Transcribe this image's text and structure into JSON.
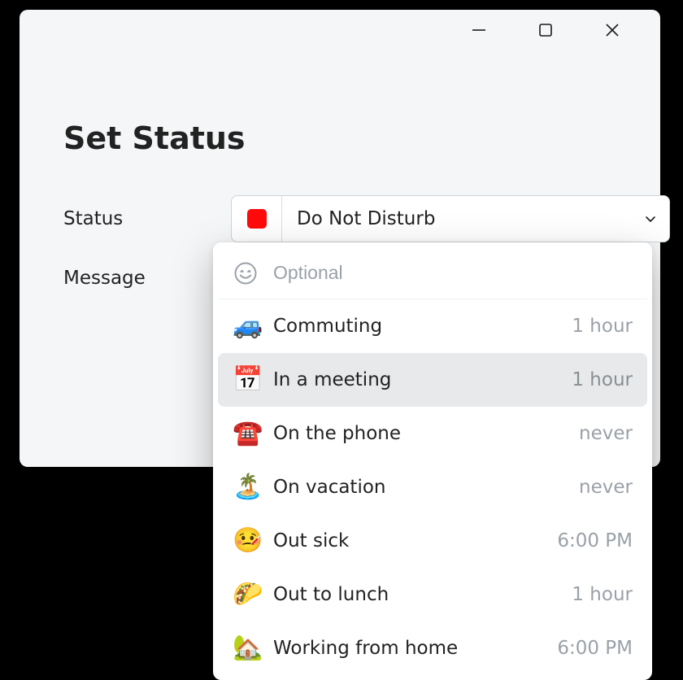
{
  "window": {
    "title": "Set Status"
  },
  "fields": {
    "status_label": "Status",
    "message_label": "Message"
  },
  "status_select": {
    "value": "Do Not Disturb",
    "color": "#ff0a0a"
  },
  "message_input": {
    "placeholder": "Optional",
    "value": ""
  },
  "suggestions": [
    {
      "icon": "🚙",
      "label": "Commuting",
      "meta": "1 hour",
      "highlight": false
    },
    {
      "icon": "📅",
      "label": "In a meeting",
      "meta": "1 hour",
      "highlight": true
    },
    {
      "icon": "☎️",
      "label": "On the phone",
      "meta": "never",
      "highlight": false
    },
    {
      "icon": "🏝️",
      "label": "On vacation",
      "meta": "never",
      "highlight": false
    },
    {
      "icon": "🤒",
      "label": "Out sick",
      "meta": "6:00 PM",
      "highlight": false
    },
    {
      "icon": "🌮",
      "label": "Out to lunch",
      "meta": "1 hour",
      "highlight": false
    },
    {
      "icon": "🏡",
      "label": "Working from home",
      "meta": "6:00 PM",
      "highlight": false
    }
  ]
}
